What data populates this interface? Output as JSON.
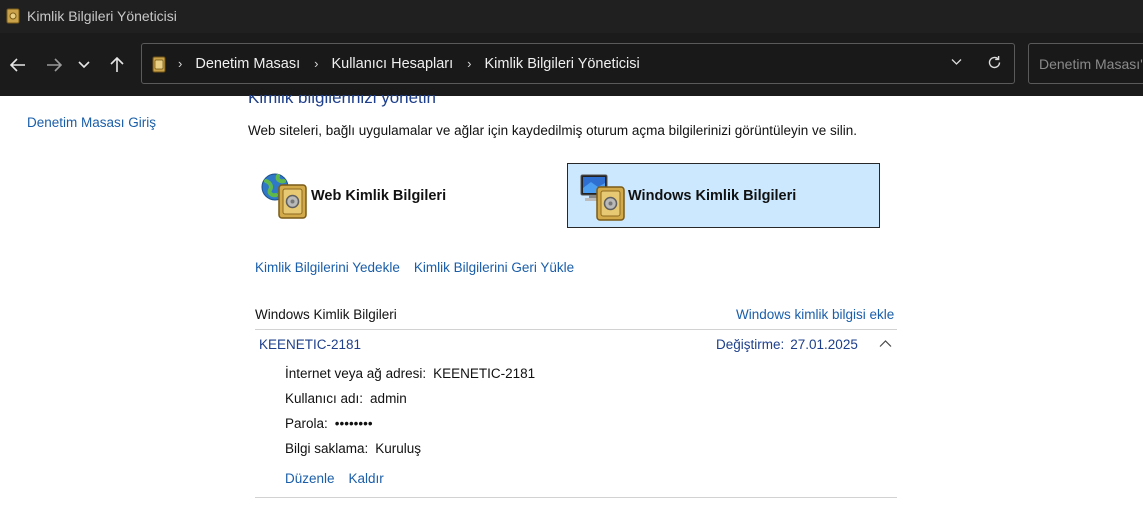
{
  "window": {
    "title": "Kimlik Bilgileri Yöneticisi"
  },
  "breadcrumbs": [
    "Denetim Masası",
    "Kullanıcı Hesapları",
    "Kimlik Bilgileri Yöneticisi"
  ],
  "search": {
    "placeholder": "Denetim Masası'nda Ara"
  },
  "sidebar": {
    "home_link": "Denetim Masası Giriş"
  },
  "main": {
    "heading": "Kimlik bilgilerinizi yönetin",
    "description": "Web siteleri, bağlı uygulamalar ve ağlar için kaydedilmiş oturum açma bilgilerinizi görüntüleyin ve silin.",
    "tiles": {
      "web": "Web Kimlik Bilgileri",
      "windows": "Windows Kimlik Bilgileri"
    },
    "backup_link": "Kimlik Bilgilerini Yedekle",
    "restore_link": "Kimlik Bilgilerini Geri Yükle",
    "section_title": "Windows Kimlik Bilgileri",
    "add_link": "Windows kimlik bilgisi ekle",
    "credential": {
      "name": "KEENETIC-2181",
      "modified_label": "Değiştirme:",
      "modified_date": "27.01.2025",
      "address_label": "İnternet veya ağ adresi:",
      "address": "KEENETIC-2181",
      "username_label": "Kullanıcı adı:",
      "username": "admin",
      "password_label": "Parola:",
      "password": "••••••••",
      "persistence_label": "Bilgi saklama:",
      "persistence": "Kuruluş",
      "edit_link": "Düzenle",
      "remove_link": "Kaldır"
    }
  },
  "colors": {
    "link": "#1a5ea9",
    "selected_tile": "#cce8ff",
    "titlebar": "#202020"
  },
  "icons": [
    "vault-icon",
    "back-arrow-icon",
    "forward-arrow-icon",
    "recent-dropdown-icon",
    "up-arrow-icon",
    "folder-icon",
    "chevron-right-icon",
    "chevron-down-icon",
    "refresh-icon",
    "globe-vault-icon",
    "computer-vault-icon",
    "chevron-up-icon"
  ]
}
